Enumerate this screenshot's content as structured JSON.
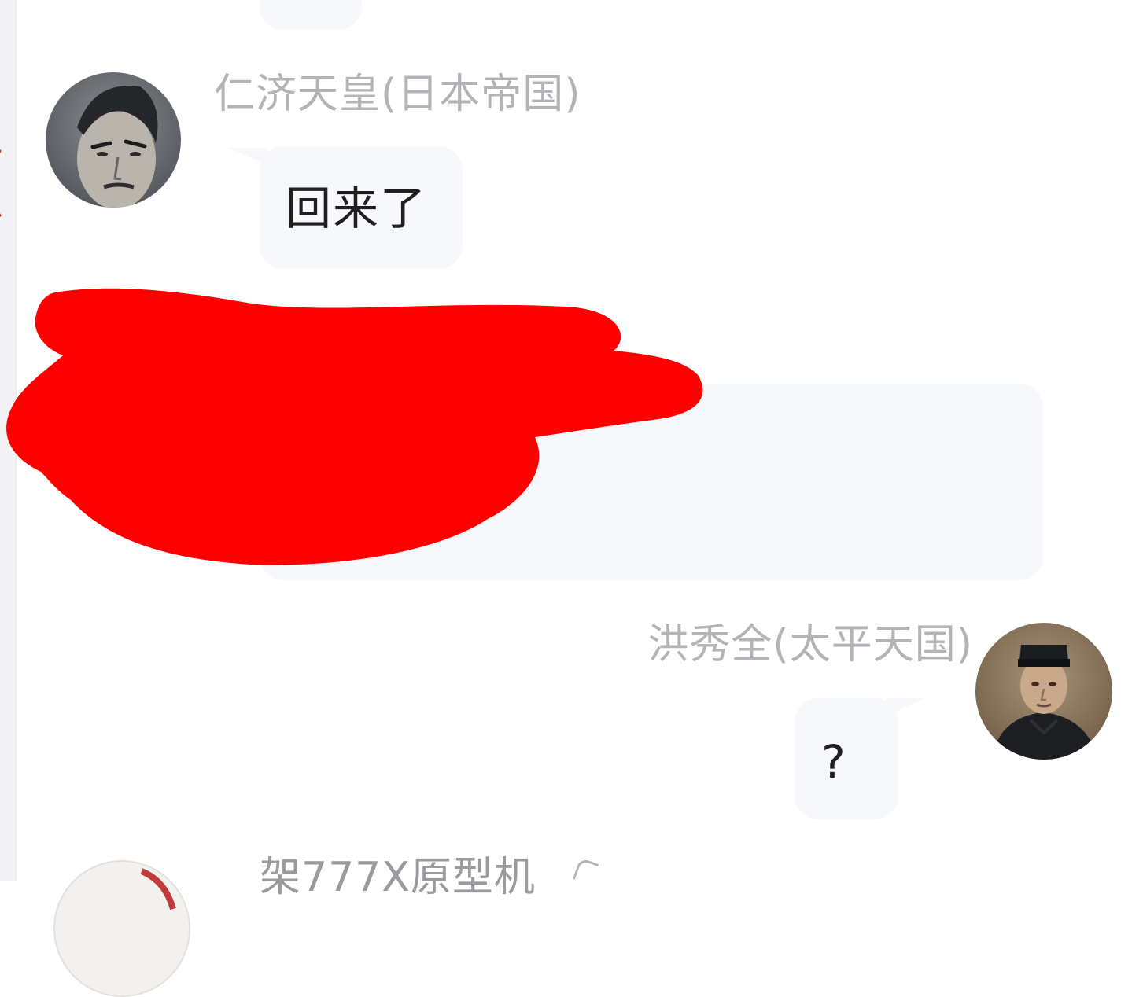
{
  "chat": {
    "messages": [
      {
        "sender": "仁济天皇(日本帝国)",
        "text": "回来了",
        "side": "left",
        "avatar": "person-avatar"
      },
      {
        "sender": "",
        "text": "",
        "side": "left",
        "redacted": true
      },
      {
        "sender": "洪秀全(太平天国)",
        "text": "?",
        "side": "right",
        "avatar": "person-avatar"
      },
      {
        "sender": "架777X原型机",
        "text": "",
        "side": "left",
        "partial": true
      }
    ]
  },
  "colors": {
    "bubble": "#f7f8fc",
    "sender_name": "#b4b4b8",
    "message_text": "#1f1f1f",
    "redaction": "#ff0000"
  },
  "icons": {
    "redaction_mark": "red-scribble"
  }
}
